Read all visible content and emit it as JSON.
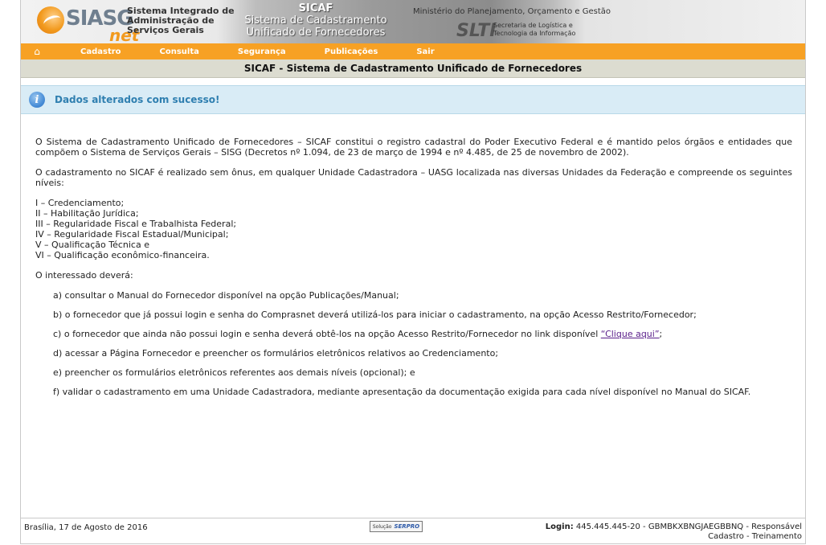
{
  "header": {
    "logo_text": "SIASG",
    "logo_net": "net",
    "sisg_line1": "Sistema Integrado de",
    "sisg_line2": "Administração de",
    "sisg_line3": "Serviços Gerais",
    "sicaf_line1": "SICAF",
    "sicaf_line2": "Sistema de Cadastramento",
    "sicaf_line3": "Unificado de Fornecedores",
    "ministerio": "Ministério do Planejamento, Orçamento e Gestão",
    "slti_logo": "SLTI",
    "slti_line1": "Secretaria de Logística e",
    "slti_line2": "Tecnologia da Informação"
  },
  "nav": {
    "home_icon": "home-icon",
    "items": [
      "Cadastro",
      "Consulta",
      "Segurança",
      "Publicações",
      "Sair"
    ]
  },
  "page_title": "SICAF - Sistema de Cadastramento Unificado de Fornecedores",
  "message": {
    "icon": "info-icon",
    "text": "Dados alterados com sucesso!"
  },
  "content": {
    "p1": "O Sistema de Cadastramento Unificado de Fornecedores – SICAF constitui o registro cadastral do Poder Executivo Federal e é mantido pelos órgãos e entidades que compõem o Sistema de Serviços Gerais – SISG (Decretos nº 1.094, de 23 de março de 1994 e nº 4.485, de 25 de novembro de 2002).",
    "p2": "O cadastramento no SICAF é realizado sem ônus, em qualquer Unidade Cadastradora – UASG localizada nas diversas Unidades da Federação e compreende os seguintes níveis:",
    "levels": [
      "I – Credenciamento;",
      "II – Habilitação Jurídica;",
      "III – Regularidade Fiscal e Trabalhista Federal;",
      "IV – Regularidade Fiscal Estadual/Municipal;",
      "V – Qualificação Técnica e",
      "VI – Qualificação econômico-financeira."
    ],
    "p3": "O interessado deverá:",
    "step_a": "a) consultar o Manual do Fornecedor disponível na opção Publicações/Manual;",
    "step_b": "b) o fornecedor que já possui login e senha do Comprasnet deverá utilizá-los para iniciar o cadastramento, na opção Acesso Restrito/Fornecedor;",
    "step_c_prefix": "c) o fornecedor que ainda não possui login e senha deverá obtê-los na opção Acesso Restrito/Fornecedor no link disponível ",
    "step_c_link": "“Clique aqui”",
    "step_c_suffix": ";",
    "step_d": "d) acessar a Página Fornecedor e preencher os formulários eletrônicos relativos ao Credenciamento;",
    "step_e": "e) preencher os formulários eletrônicos referentes aos demais níveis (opcional); e",
    "step_f": "f) validar o cadastramento em uma Unidade Cadastradora, mediante apresentação da documentação exigida para cada nível disponível no Manual do SICAF."
  },
  "footer": {
    "date": "Brasília, 17 de Agosto de 2016",
    "serpro_label": "Solução",
    "serpro_brand": "SERPRO",
    "login_label": "Login:",
    "login_value": " 445.445.445-20 - GBMBKXBNGJAEGBBNQ - Responsável",
    "login_line2": "Cadastro - Treinamento"
  }
}
